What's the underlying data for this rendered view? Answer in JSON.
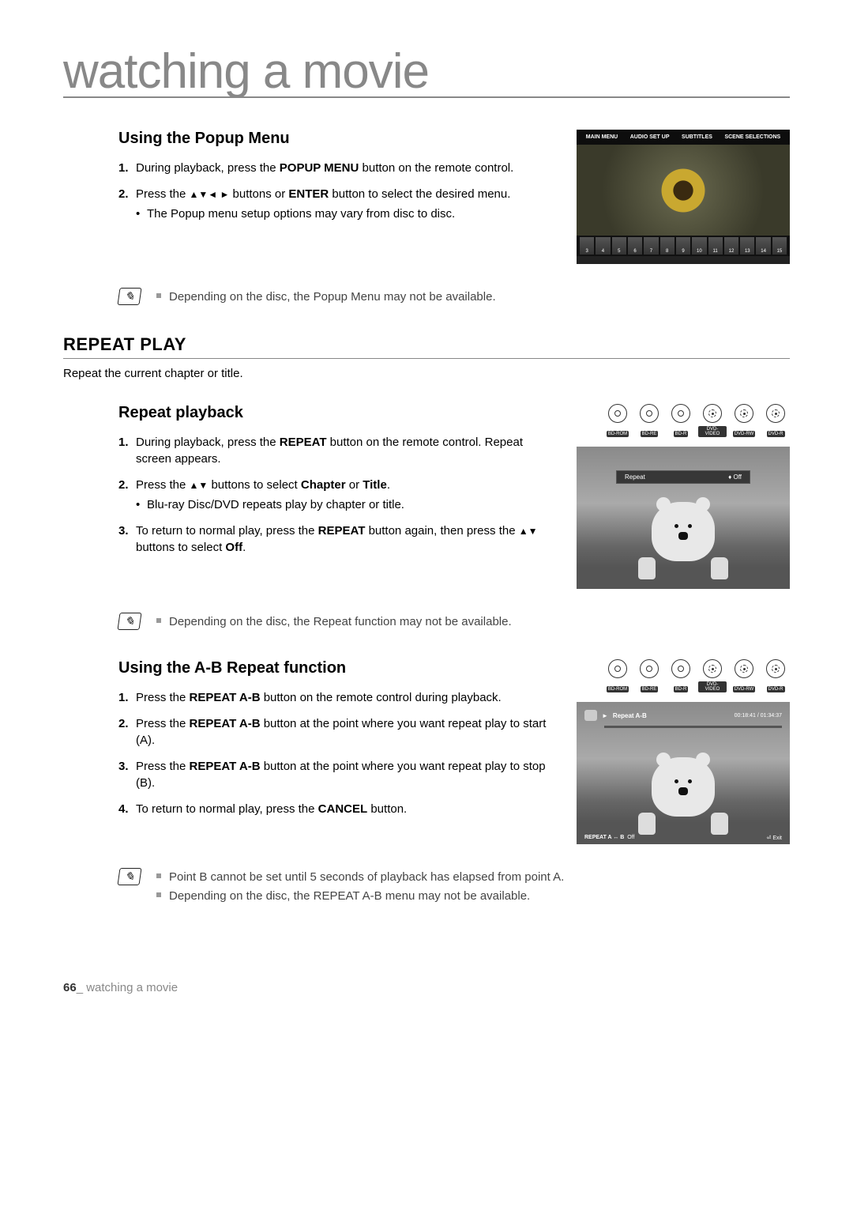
{
  "page": {
    "title": "watching a movie",
    "number": "66",
    "footer_text": "watching a movie"
  },
  "top_disc": {
    "label": "BD-ROM"
  },
  "popup_menu": {
    "heading": "Using the Popup Menu",
    "steps": [
      {
        "num": "1.",
        "before": "During playback, press the ",
        "bold1": "POPUP MENU",
        "after": " button on the remote control."
      },
      {
        "num": "2.",
        "before": "Press the ",
        "arrows": "▲▼◄ ►",
        "mid": " buttons or ",
        "bold1": "ENTER",
        "after": " button to select the desired menu.",
        "bullet": "The Popup menu setup options may vary from disc to disc."
      }
    ],
    "note": "Depending on the disc, the Popup Menu may not be available.",
    "screenshot": {
      "menu_items": [
        "MAIN MENU",
        "AUDIO SET UP",
        "SUBTITLES",
        "SCENE SELECTIONS"
      ],
      "thumbs": [
        "3",
        "4",
        "5",
        "6",
        "7",
        "8",
        "9",
        "10",
        "11",
        "12",
        "13",
        "14",
        "15"
      ]
    }
  },
  "repeat_play": {
    "heading": "REPEAT PLAY",
    "desc": "Repeat the current chapter or title."
  },
  "repeat_playback": {
    "heading": "Repeat playback",
    "disc_labels": [
      "BD-ROM",
      "BD-RE",
      "BD-R",
      "DVD-VIDEO",
      "DVD-RW",
      "DVD-R"
    ],
    "steps": [
      {
        "num": "1.",
        "before": "During playback, press the ",
        "bold1": "REPEAT",
        "after": " button on the remote control. Repeat screen appears."
      },
      {
        "num": "2.",
        "before": "Press the ",
        "arrows": "▲▼",
        "mid": " buttons to select ",
        "bold1": "Chapter",
        "mid2": " or ",
        "bold2": "Title",
        "after": ".",
        "bullet": "Blu-ray Disc/DVD repeats play by chapter or title."
      },
      {
        "num": "3.",
        "before": "To return to normal play, press the ",
        "bold1": "REPEAT",
        "mid": " button again, then press the ",
        "arrows": "▲▼",
        "mid2": " buttons to select ",
        "bold2": "Off",
        "after": "."
      }
    ],
    "note": "Depending on the disc, the Repeat function may not be available.",
    "screenshot": {
      "label": "Repeat",
      "value": "Off",
      "value_prefix": "♦"
    }
  },
  "ab_repeat": {
    "heading": "Using the A-B Repeat function",
    "disc_labels": [
      "BD-ROM",
      "BD-RE",
      "BD-R",
      "DVD-VIDEO",
      "DVD-RW",
      "DVD-R"
    ],
    "steps": [
      {
        "num": "1.",
        "before": "Press the ",
        "bold1": "REPEAT A-B",
        "after": " button on the remote control during playback."
      },
      {
        "num": "2.",
        "before": "Press the  ",
        "bold1": "REPEAT A-B",
        "after": " button at the point where you want repeat play to start (A)."
      },
      {
        "num": "3.",
        "before": "Press the  ",
        "bold1": "REPEAT A-B",
        "after": " button at the point where you want repeat play to stop (B)."
      },
      {
        "num": "4.",
        "before": "To return to normal play, press the ",
        "bold1": "CANCEL",
        "after": " button."
      }
    ],
    "notes": [
      "Point B cannot be set until 5 seconds of playback has elapsed from point A.",
      "Depending on the disc, the REPEAT A-B menu may not be available."
    ],
    "screenshot": {
      "title": "Repeat A-B",
      "time": "00:18:41 / 01:34:37",
      "bottom_left_label": "REPEAT A ↔ B",
      "bottom_left_value": "Off",
      "bottom_right": "Exit"
    }
  }
}
